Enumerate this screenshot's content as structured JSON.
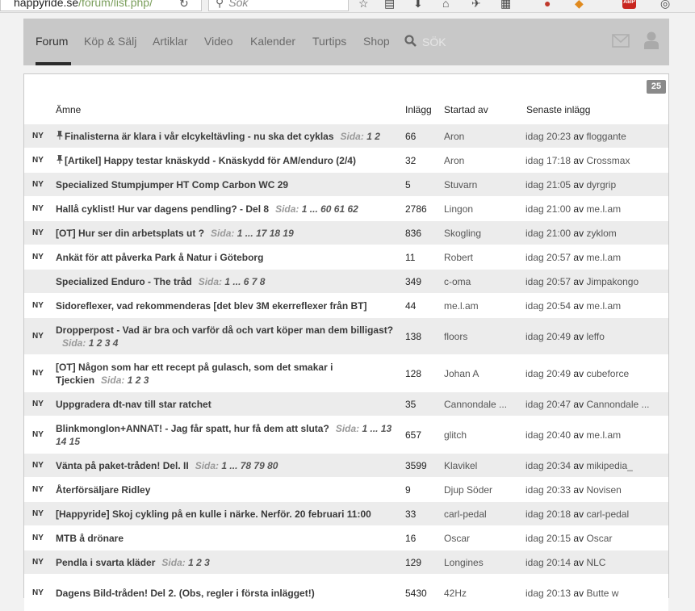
{
  "browser": {
    "url_host": "happyride.se",
    "url_path": "/forum/list.php/",
    "search_placeholder": "Sök"
  },
  "nav": {
    "items": [
      {
        "label": "Forum",
        "active": true
      },
      {
        "label": "Köp & Sälj"
      },
      {
        "label": "Artiklar"
      },
      {
        "label": "Video"
      },
      {
        "label": "Kalender"
      },
      {
        "label": "Turtips"
      },
      {
        "label": "Shop"
      }
    ],
    "search_label": "SÖK"
  },
  "forum": {
    "count_badge": "25",
    "headers": {
      "subject": "Ämne",
      "posts": "Inlägg",
      "started_by": "Startad av",
      "latest": "Senaste inlägg"
    },
    "av_label": "av",
    "sida_label": "Sida:",
    "threads": [
      {
        "new": "NY",
        "pinned": true,
        "title": "Finalisterna är klara i vår elcykeltävling - nu ska det cyklas",
        "pages": "1 2",
        "posts": "66",
        "author": "Aron",
        "latest_time": "idag 20:23",
        "latest_by": "floggante"
      },
      {
        "new": "NY",
        "pinned": true,
        "title": "[Artikel] Happy testar knäskydd - Knäskydd för AM/enduro (2/4)",
        "pages": "",
        "posts": "32",
        "author": "Aron",
        "latest_time": "idag 17:18",
        "latest_by": "Crossmax"
      },
      {
        "new": "NY",
        "pinned": false,
        "title": "Specialized Stumpjumper HT Comp Carbon WC 29",
        "pages": "",
        "posts": "5",
        "author": "Stuvarn",
        "latest_time": "idag 21:05",
        "latest_by": "dyrgrip"
      },
      {
        "new": "NY",
        "pinned": false,
        "title": "Hallå cyklist! Hur var dagens pendling? - Del 8",
        "pages": "1 ... 60 61 62",
        "posts": "2786",
        "author": "Lingon",
        "latest_time": "idag 21:00",
        "latest_by": "me.l.am"
      },
      {
        "new": "NY",
        "pinned": false,
        "title": "[OT] Hur ser din arbetsplats ut ?",
        "pages": "1 ... 17 18 19",
        "posts": "836",
        "author": "Skogling",
        "latest_time": "idag 21:00",
        "latest_by": "zyklom"
      },
      {
        "new": "NY",
        "pinned": false,
        "title": "Ankät för att påverka Park å Natur i Göteborg",
        "pages": "",
        "posts": "11",
        "author": "Robert",
        "latest_time": "idag 20:57",
        "latest_by": "me.l.am"
      },
      {
        "new": "",
        "pinned": false,
        "title": "Specialized Enduro - The tråd",
        "pages": "1 ... 6 7 8",
        "posts": "349",
        "author": "c-oma",
        "latest_time": "idag 20:57",
        "latest_by": "Jimpakongo"
      },
      {
        "new": "NY",
        "pinned": false,
        "title": "Sidoreflexer, vad rekommenderas [det blev 3M ekerreflexer från BT]",
        "pages": "",
        "posts": "44",
        "author": "me.l.am",
        "latest_time": "idag 20:54",
        "latest_by": "me.l.am"
      },
      {
        "new": "NY",
        "pinned": false,
        "title": "Dropperpost - Vad är bra och varför då och vart köper man dem billigast?",
        "pages": "1 2 3 4",
        "posts": "138",
        "author": "floors",
        "latest_time": "idag 20:49",
        "latest_by": "leffo",
        "tall": true
      },
      {
        "new": "NY",
        "pinned": false,
        "title": "[OT] Någon som har ett recept på gulasch, som det smakar i Tjeckien",
        "pages": "1 2 3",
        "posts": "128",
        "author": "Johan A",
        "latest_time": "idag 20:49",
        "latest_by": "cubeforce",
        "tall": true
      },
      {
        "new": "NY",
        "pinned": false,
        "title": "Uppgradera dt-nav till star ratchet",
        "pages": "",
        "posts": "35",
        "author": "Cannondale ...",
        "latest_time": "idag 20:47",
        "latest_by": "Cannondale ..."
      },
      {
        "new": "NY",
        "pinned": false,
        "title": "Blinkmonglon+ANNAT! - Jag får spatt, hur få dem att sluta?",
        "pages": "1 ... 13 14 15",
        "posts": "657",
        "author": "glitch",
        "latest_time": "idag 20:40",
        "latest_by": "me.l.am",
        "tall": true
      },
      {
        "new": "NY",
        "pinned": false,
        "title": "Vänta på paket-tråden! Del. II",
        "pages": "1 ... 78 79 80",
        "posts": "3599",
        "author": "Klavikel",
        "latest_time": "idag 20:34",
        "latest_by": "mikipedia_"
      },
      {
        "new": "NY",
        "pinned": false,
        "title": "Återförsäljare Ridley",
        "pages": "",
        "posts": "9",
        "author": "Djup Söder",
        "latest_time": "idag 20:33",
        "latest_by": "Novisen"
      },
      {
        "new": "NY",
        "pinned": false,
        "title": "[Happyride] Skoj cykling på en kulle i närke. Nerför. 20 februari 11:00",
        "pages": "",
        "posts": "33",
        "author": "carl-pedal",
        "latest_time": "idag 20:18",
        "latest_by": "carl-pedal"
      },
      {
        "new": "NY",
        "pinned": false,
        "title": "MTB å drönare",
        "pages": "",
        "posts": "16",
        "author": "Oscar",
        "latest_time": "idag 20:15",
        "latest_by": "Oscar"
      },
      {
        "new": "NY",
        "pinned": false,
        "title": "Pendla i svarta kläder",
        "pages": "1 2 3",
        "posts": "129",
        "author": "Longines",
        "latest_time": "idag 20:14",
        "latest_by": "NLC"
      },
      {
        "new": "NY",
        "pinned": false,
        "title": "Dagens Bild-tråden! Del 2. (Obs, regler i första inlägget!)",
        "pages": "",
        "posts": "5430",
        "author": "42Hz",
        "latest_time": "idag 20:13",
        "latest_by": "Butte w",
        "tall": true
      }
    ]
  }
}
